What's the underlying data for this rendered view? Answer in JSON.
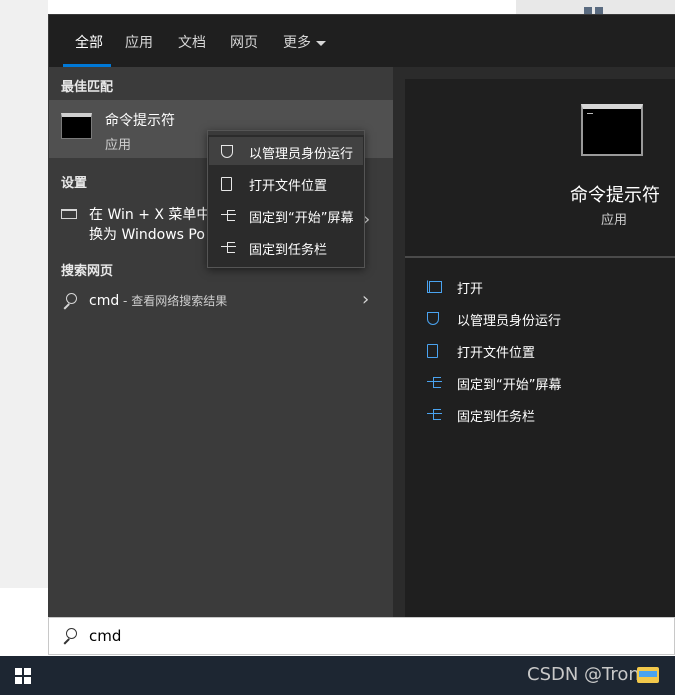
{
  "tabs": [
    {
      "label": "全部"
    },
    {
      "label": "应用"
    },
    {
      "label": "文档"
    },
    {
      "label": "网页"
    },
    {
      "label": "更多"
    }
  ],
  "left": {
    "best_match_header": "最佳匹配",
    "best_match": {
      "title": "命令提示符",
      "subtitle": "应用"
    },
    "settings_header": "设置",
    "setting_item": {
      "line1": "在 Win + X 菜单中",
      "line2": "换为 Windows Po"
    },
    "web_header": "搜索网页",
    "web_item": {
      "query": "cmd",
      "hint": " - 查看网络搜索结果"
    }
  },
  "context_menu": [
    {
      "label": "以管理员身份运行",
      "icon": "shield-icon"
    },
    {
      "label": "打开文件位置",
      "icon": "file-location-icon"
    },
    {
      "label": "固定到“开始”屏幕",
      "icon": "pin-icon"
    },
    {
      "label": "固定到任务栏",
      "icon": "pin-icon"
    }
  ],
  "right": {
    "title": "命令提示符",
    "subtitle": "应用",
    "actions": [
      {
        "label": "打开",
        "icon": "open-icon"
      },
      {
        "label": "以管理员身份运行",
        "icon": "shield-icon"
      },
      {
        "label": "打开文件位置",
        "icon": "file-location-icon"
      },
      {
        "label": "固定到“开始”屏幕",
        "icon": "pin-icon"
      },
      {
        "label": "固定到任务栏",
        "icon": "pin-icon"
      }
    ]
  },
  "search": {
    "value": "cmd"
  },
  "taskbar": {
    "watermark": "CSDN @Tron"
  },
  "colors": {
    "accent": "#0078d7",
    "icon_blue": "#4aa3f0",
    "panel": "#2b2b2b",
    "taskbar": "#1d2632"
  }
}
